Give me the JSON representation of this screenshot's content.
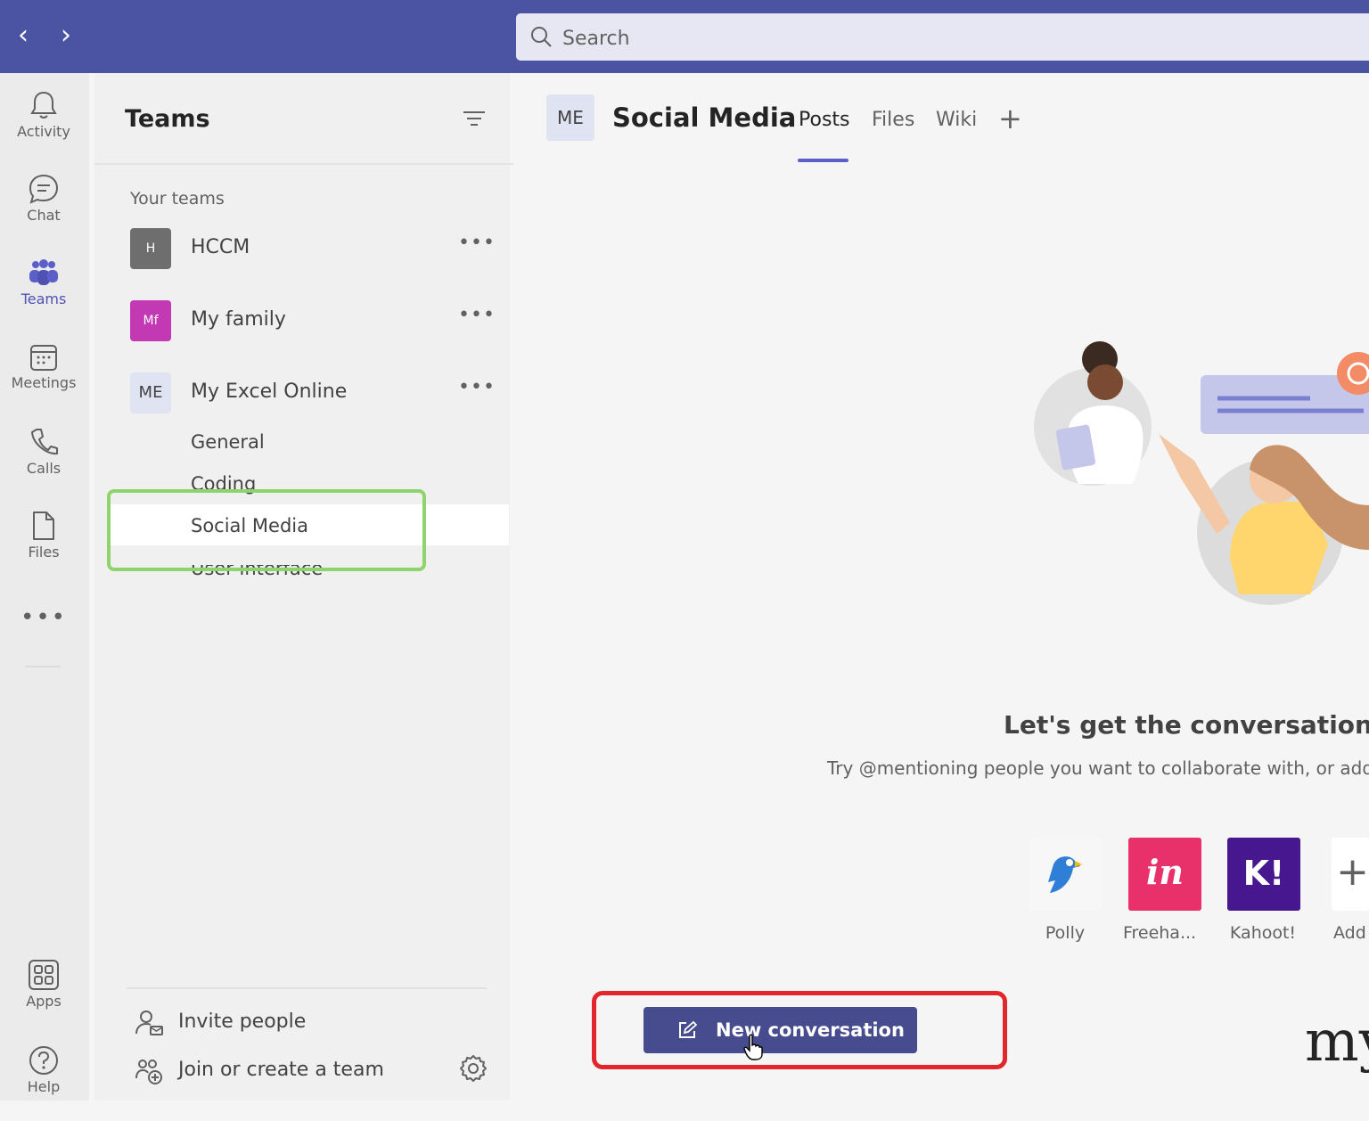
{
  "nav": {
    "back_glyph": "‹",
    "forward_glyph": "›"
  },
  "search": {
    "placeholder": "Search",
    "icon": "search-icon"
  },
  "rail": {
    "items": [
      {
        "label": "Activity",
        "icon": "bell-icon"
      },
      {
        "label": "Chat",
        "icon": "chat-icon"
      },
      {
        "label": "Teams",
        "icon": "teams-icon",
        "active": true
      },
      {
        "label": "Meetings",
        "icon": "calendar-icon"
      },
      {
        "label": "Calls",
        "icon": "phone-icon"
      },
      {
        "label": "Files",
        "icon": "file-icon"
      }
    ],
    "more": "•••",
    "bottom": [
      {
        "label": "Apps",
        "icon": "apps-icon"
      },
      {
        "label": "Help",
        "icon": "help-icon"
      }
    ]
  },
  "panel": {
    "title": "Teams",
    "section_label": "Your teams",
    "teams": [
      {
        "initials": "H",
        "name": "HCCM",
        "more": "•••"
      },
      {
        "initials": "Mf",
        "name": "My family",
        "more": "•••"
      },
      {
        "initials": "ME",
        "name": "My Excel Online",
        "more": "•••"
      }
    ],
    "channels": [
      "General",
      "Coding",
      "Social Media",
      "User interface"
    ],
    "selected_channel": "Social Media",
    "invite_label": "Invite people",
    "join_label": "Join or create a team"
  },
  "main": {
    "channel_initials": "ME",
    "channel_title": "Social Media",
    "tabs": [
      "Posts",
      "Files",
      "Wiki"
    ],
    "active_tab": "Posts",
    "add_tab_glyph": "+",
    "empty_title": "Let's get the conversation sta",
    "empty_subtitle": "Try @mentioning people you want to collaborate with, or add some",
    "apps": [
      {
        "label": "Polly",
        "glyph": "",
        "color": "#ffffff"
      },
      {
        "label": "Freeha...",
        "glyph": "in",
        "color": "#e8306a"
      },
      {
        "label": "Kahoot!",
        "glyph": "K!",
        "color": "#46178f"
      },
      {
        "label": "Add",
        "glyph": "+",
        "color": "#ffffff"
      }
    ],
    "new_conversation_label": "New conversation",
    "brand_fragment": "my"
  },
  "colors": {
    "topbar": "#4b53a3",
    "accent": "#5b5fc7",
    "highlight_green": "#8fd46a",
    "highlight_red": "#e3262b",
    "button": "#464c8e"
  }
}
